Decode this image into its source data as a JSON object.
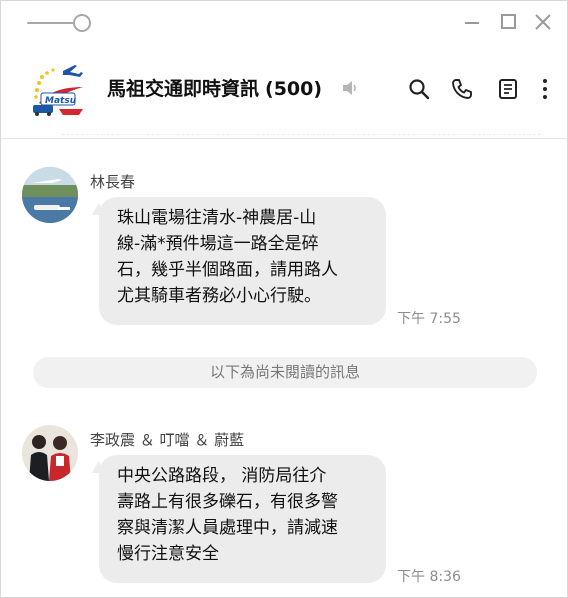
{
  "window": {
    "controls": [
      "minimize",
      "maximize",
      "close"
    ]
  },
  "header": {
    "title": "馬祖交通即時資訊",
    "member_count": "(500)",
    "logo_text": "Matsu",
    "icons": [
      "search-icon",
      "phone-icon",
      "notes-icon",
      "more-icon",
      "speaker-muted-icon"
    ]
  },
  "messages": [
    {
      "sender": "林長春",
      "lines": [
        " 珠山電場往清水-神農居-山",
        "線-滿*預件場這一路全是碎",
        "石，幾乎半個路面，請用路人",
        "尤其騎車者務必小心行駛。"
      ],
      "time": "下午 7:55"
    },
    {
      "sender": "李政震 ＆ 叮噹 ＆ 蔚藍",
      "lines": [
        "中央公路路段， 消防局往介",
        "壽路上有很多礫石，有很多警",
        "察與清潔人員處理中，請減速",
        "慢行注意安全"
      ],
      "time": "下午 8:36"
    }
  ],
  "divider_text": "以下為尚未閱讀的訊息",
  "colors": {
    "bubble": "#ececec",
    "divider": "#f1f1f1",
    "logo_red": "#d6262f",
    "logo_blue": "#1e56a6",
    "logo_yellow": "#f3c21b"
  }
}
